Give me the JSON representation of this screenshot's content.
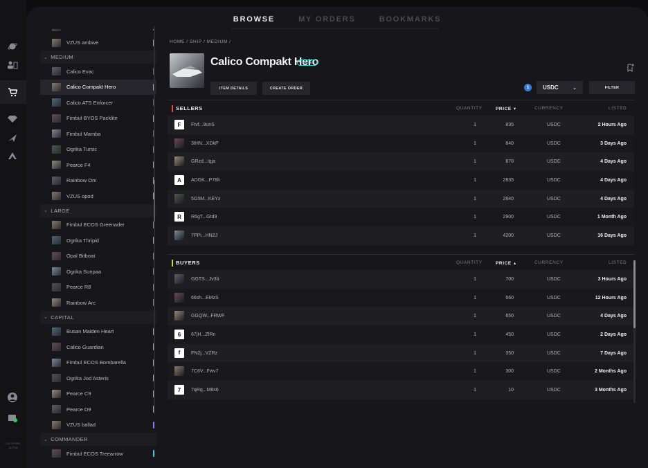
{
  "rail": {
    "version": "0.5179 PRE-ALPHA"
  },
  "tabs": [
    {
      "label": "BROWSE",
      "active": true
    },
    {
      "label": "MY ORDERS",
      "active": false
    },
    {
      "label": "BOOKMARKS",
      "active": false
    }
  ],
  "sidebar": {
    "top_partial": [
      {
        "label": "VZUS Pulse",
        "bar_color": "#8b7cf6"
      },
      {
        "label": "VZUS ambwe",
        "bar_color": "#3fd1d8"
      }
    ],
    "categories": [
      {
        "label": "MEDIUM",
        "items": [
          {
            "label": "Calico Evac",
            "bar_color": "#e03c3c",
            "selected": false
          },
          {
            "label": "Calico Compakt Hero",
            "bar_color": "#3fd1d8",
            "selected": true
          },
          {
            "label": "Calico ATS Enforcer",
            "bar_color": "#e03c3c",
            "selected": false
          },
          {
            "label": "Fimbul BYOS Packlite",
            "bar_color": "#3fd1d8",
            "selected": false
          },
          {
            "label": "Fimbul Mamba",
            "bar_color": "#e03c3c",
            "selected": false
          },
          {
            "label": "Ogrika Tursic",
            "bar_color": "#8b7cf6",
            "selected": false
          },
          {
            "label": "Pearce F4",
            "bar_color": "#3fd1d8",
            "selected": false
          },
          {
            "label": "Rainbow Om",
            "bar_color": "#3fd1d8",
            "selected": false
          },
          {
            "label": "VZUS opod",
            "bar_color": "#3fd1d8",
            "selected": false
          }
        ]
      },
      {
        "label": "LARGE",
        "items": [
          {
            "label": "Fimbul ECOS Greenader",
            "bar_color": "#8b7cf6",
            "selected": false
          },
          {
            "label": "Ogrika Thripid",
            "bar_color": "#f5a623",
            "selected": false
          },
          {
            "label": "Opal Bitboat",
            "bar_color": "#8b7cf6",
            "selected": false
          },
          {
            "label": "Ogrika Sunpaa",
            "bar_color": "#8b7cf6",
            "selected": false
          },
          {
            "label": "Pearce R8",
            "bar_color": "#8b7cf6",
            "selected": false
          },
          {
            "label": "Rainbow Arc",
            "bar_color": "#8b7cf6",
            "selected": false
          }
        ]
      },
      {
        "label": "CAPITAL",
        "items": [
          {
            "label": "Busan Maiden Heart",
            "bar_color": "#f5a623",
            "selected": false
          },
          {
            "label": "Calico Guardian",
            "bar_color": "#f5a623",
            "selected": false
          },
          {
            "label": "Fimbul ECOS Bombarella",
            "bar_color": "#f5a623",
            "selected": false
          },
          {
            "label": "Ogrika Jod Asteris",
            "bar_color": "#f5a623",
            "selected": false
          },
          {
            "label": "Pearce C9",
            "bar_color": "#f5a623",
            "selected": false
          },
          {
            "label": "Pearce D9",
            "bar_color": "#f5a623",
            "selected": false
          },
          {
            "label": "VZUS ballad",
            "bar_color": "#8b7cf6",
            "selected": false
          }
        ]
      },
      {
        "label": "COMMANDER",
        "items": [
          {
            "label": "Fimbul ECOS Treearrow",
            "bar_color": "#3fd1d8",
            "selected": false
          }
        ]
      }
    ]
  },
  "breadcrumb": "HOME / SHIP / MEDIUM /",
  "item": {
    "title": "Calico Compakt Hero",
    "badge": "BASE",
    "details_button": "ITEM DETAILS",
    "create_order_button": "CREATE ORDER"
  },
  "currency": {
    "icon": "usdc-coin-icon",
    "selected": "USDC",
    "filter_button": "FILTER"
  },
  "sellers": {
    "title": "SELLERS",
    "accent": "#e0542e",
    "columns": {
      "quantity": "QUANTITY",
      "price": "PRICE",
      "price_sort": "▾",
      "currency": "CURRENCY",
      "listed": "LISTED"
    },
    "rows": [
      {
        "avatar": "F",
        "name": "Ftvf...9unS",
        "quantity": "1",
        "price": "835",
        "currency": "USDC",
        "listed": "2 Hours Ago"
      },
      {
        "avatar": "",
        "name": "3tHN...XDkP",
        "quantity": "1",
        "price": "840",
        "currency": "USDC",
        "listed": "3 Days Ago"
      },
      {
        "avatar": "",
        "name": "GRzd...Iqja",
        "quantity": "1",
        "price": "870",
        "currency": "USDC",
        "listed": "4 Days Ago"
      },
      {
        "avatar": "A",
        "name": "ADGK...P78h",
        "quantity": "1",
        "price": "2835",
        "currency": "USDC",
        "listed": "4 Days Ago"
      },
      {
        "avatar": "",
        "name": "5G5M...KEYz",
        "quantity": "1",
        "price": "2840",
        "currency": "USDC",
        "listed": "4 Days Ago"
      },
      {
        "avatar": "R",
        "name": "R6gT...Gtd9",
        "quantity": "1",
        "price": "2900",
        "currency": "USDC",
        "listed": "1 Month Ago"
      },
      {
        "avatar": "",
        "name": "7PPi...HN2J",
        "quantity": "1",
        "price": "4200",
        "currency": "USDC",
        "listed": "16 Days Ago"
      }
    ]
  },
  "buyers": {
    "title": "BUYERS",
    "accent": "#b8e04a",
    "columns": {
      "quantity": "QUANTITY",
      "price": "PRICE",
      "price_sort": "▴",
      "currency": "CURRENCY",
      "listed": "LISTED"
    },
    "rows": [
      {
        "avatar": "",
        "name": "GGTS...Jv3b",
        "quantity": "1",
        "price": "700",
        "currency": "USDC",
        "listed": "3 Hours Ago"
      },
      {
        "avatar": "",
        "name": "66sh...EMzS",
        "quantity": "1",
        "price": "660",
        "currency": "USDC",
        "listed": "12 Hours Ago"
      },
      {
        "avatar": "",
        "name": "GGQW...FRWF",
        "quantity": "1",
        "price": "650",
        "currency": "USDC",
        "listed": "4 Days Ago"
      },
      {
        "avatar": "6",
        "name": "67jH...ZfRn",
        "quantity": "1",
        "price": "450",
        "currency": "USDC",
        "listed": "2 Days Ago"
      },
      {
        "avatar": "f",
        "name": "FN2j...VZRz",
        "quantity": "1",
        "price": "350",
        "currency": "USDC",
        "listed": "7 Days Ago"
      },
      {
        "avatar": "",
        "name": "7C6V...Fwv7",
        "quantity": "1",
        "price": "300",
        "currency": "USDC",
        "listed": "2 Months Ago"
      },
      {
        "avatar": "7",
        "name": "7qRq...M8s6",
        "quantity": "1",
        "price": "10",
        "currency": "USDC",
        "listed": "3 Months Ago"
      }
    ]
  }
}
